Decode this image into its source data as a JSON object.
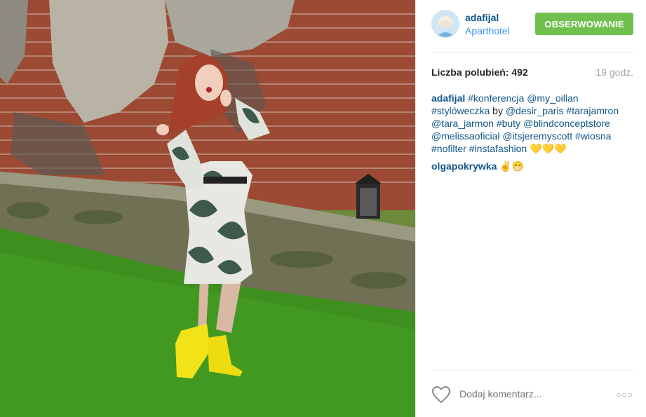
{
  "header": {
    "username": "adafijal",
    "location": "Aparthotel",
    "follow_label": "OBSERWOWANIE",
    "follow_color": "#70c050"
  },
  "stats": {
    "likes_label": "Liczba polubień: 492",
    "time": "19 godz."
  },
  "caption": {
    "username": "adafijal",
    "parts": [
      "#konferencja",
      "@my_oillan",
      "#stylóweczka",
      "by",
      "@desir_paris",
      "#tarajamron",
      "@tara_jarmon",
      "#buty",
      "@blindconceptstore",
      "@melissaoficial",
      "@itsjeremyscott",
      "#wiosna",
      "#nofilter",
      "#instafashion"
    ],
    "emoji": "💛💛💛"
  },
  "comments": [
    {
      "username": "olgapokrywka",
      "text": "✌😁"
    }
  ],
  "footer": {
    "comment_placeholder": "Dodaj komentarz...",
    "more_label": "○○○"
  },
  "icons": {
    "like": "heart-outline-icon",
    "more": "more-options-icon"
  }
}
